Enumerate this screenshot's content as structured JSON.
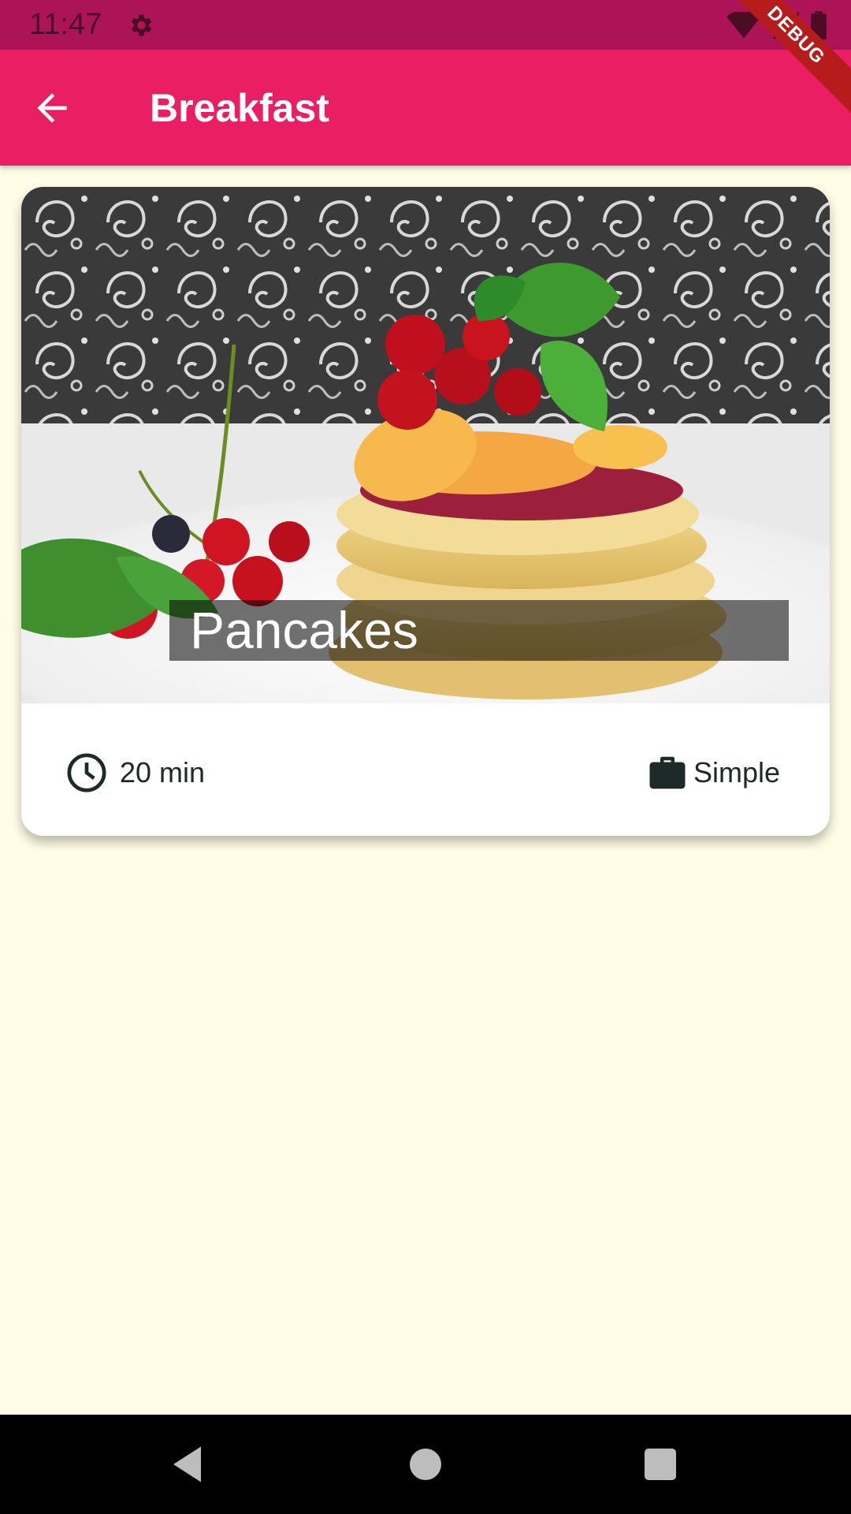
{
  "status_bar": {
    "time": "11:47",
    "icons": [
      "gear-icon",
      "wifi-icon",
      "signal-icon",
      "battery-icon"
    ]
  },
  "debug_banner": {
    "label": "DEBUG"
  },
  "app_bar": {
    "title": "Breakfast",
    "back_icon": "arrow-back-icon",
    "color": "#E91E63"
  },
  "recipe_card": {
    "title": "Pancakes",
    "duration": "20 min",
    "complexity": "Simple",
    "duration_icon": "clock-icon",
    "complexity_icon": "briefcase-icon"
  },
  "nav_bar": {
    "buttons": [
      "back-triangle-icon",
      "home-circle-icon",
      "recents-square-icon"
    ]
  },
  "colors": {
    "status_bar": "#AD1457",
    "app_bar": "#E91E63",
    "background": "#FFFDE6",
    "debug": "#B71C1C"
  }
}
